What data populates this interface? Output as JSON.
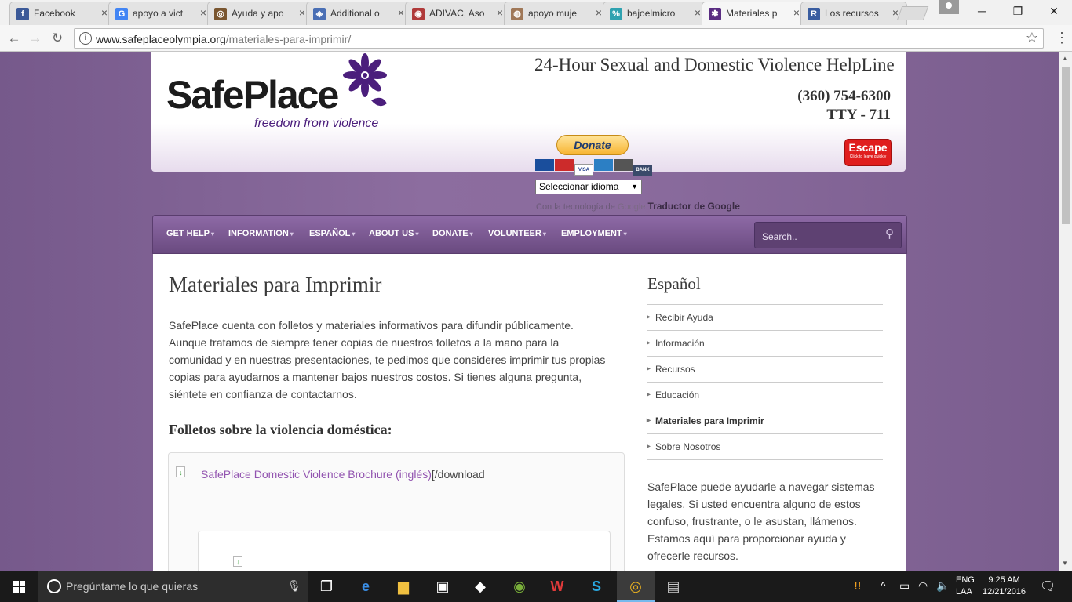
{
  "browser": {
    "tabs": [
      {
        "title": "Facebook",
        "favicon": "f",
        "color": "#3b5998"
      },
      {
        "title": "apoyo a vict",
        "favicon": "G",
        "color": "#4285f4"
      },
      {
        "title": "Ayuda y apo",
        "favicon": "◎",
        "color": "#7a5630"
      },
      {
        "title": "Additional o",
        "favicon": "◈",
        "color": "#4a6fb5"
      },
      {
        "title": "ADIVAC, Aso",
        "favicon": "◉",
        "color": "#b03a3a"
      },
      {
        "title": "apoyo muje",
        "favicon": "◍",
        "color": "#a07858"
      },
      {
        "title": "bajoelmicro",
        "favicon": "%",
        "color": "#2fa2b0"
      },
      {
        "title": "Materiales p",
        "favicon": "✱",
        "color": "#5a2d82"
      },
      {
        "title": "Los recursos",
        "favicon": "R",
        "color": "#3a5da0"
      }
    ],
    "active_tab_index": 7,
    "url_domain": "www.safeplaceolympia.org",
    "url_path": "/materiales-para-imprimir/"
  },
  "header": {
    "logo_text": "SafePlace",
    "logo_tagline": "freedom from violence",
    "helpline": "24-Hour Sexual and Domestic Violence HelpLine",
    "phone": "(360) 754-6300",
    "tty": "TTY - 711",
    "donate_label": "Donate",
    "cards": [
      "MAESTRO",
      "MASTERCARD",
      "VISA",
      "AMEX",
      "DISCOVER",
      "BANK"
    ],
    "escape_label": "Escape",
    "escape_sub": "Click to leave quickly"
  },
  "translate": {
    "select_label": "Seleccionar idioma",
    "powered_prefix": "Con la tecnología de",
    "google": "Google",
    "product": "Traductor de Google"
  },
  "nav": {
    "items": [
      "GET HELP",
      "INFORMATION",
      "ESPAÑOL",
      "ABOUT US",
      "DONATE",
      "VOLUNTEER",
      "EMPLOYMENT"
    ],
    "search_placeholder": "Search.."
  },
  "main": {
    "title": "Materiales para Imprimir",
    "intro": "SafePlace cuenta con folletos y materiales informativos para difundir públicamente. Aunque tratamos de siempre tener copias de nuestros folletos a la mano para la comunidad y en nuestras presentaciones, te pedimos que consideres imprimir tus propias copias para ayudarnos a mantener bajos nuestros costos.  Si tienes alguna pregunta, siéntete en confianza de contactarnos.",
    "brochures_heading": "Folletos sobre la violencia doméstica:",
    "download_link": "SafePlace Domestic Violence Brochure (inglés)",
    "download_tail": "[/download"
  },
  "sidebar": {
    "title": "Español",
    "items": [
      "Recibir Ayuda",
      "Información",
      "Recursos",
      "Educación",
      "Materiales para Imprimir",
      "Sobre Nosotros"
    ],
    "active_item": "Materiales para Imprimir",
    "paragraph": "SafePlace puede ayudarle a navegar sistemas legales. Si usted encuentra alguno de estos confuso, frustrante, o le asustan, llámenos. Estamos aquí para proporcionar ayuda y ofrecerle recursos."
  },
  "taskbar": {
    "search_placeholder": "Pregúntame lo que quieras",
    "apps": [
      "task-view",
      "edge",
      "file-explorer",
      "store",
      "dropbox",
      "evernote",
      "wps-office",
      "skype",
      "chrome",
      "virtual-machine"
    ],
    "lang_line1": "ENG",
    "lang_line2": "LAA",
    "time": "9:25 AM",
    "date": "12/21/2016",
    "notifications_count": "1"
  }
}
